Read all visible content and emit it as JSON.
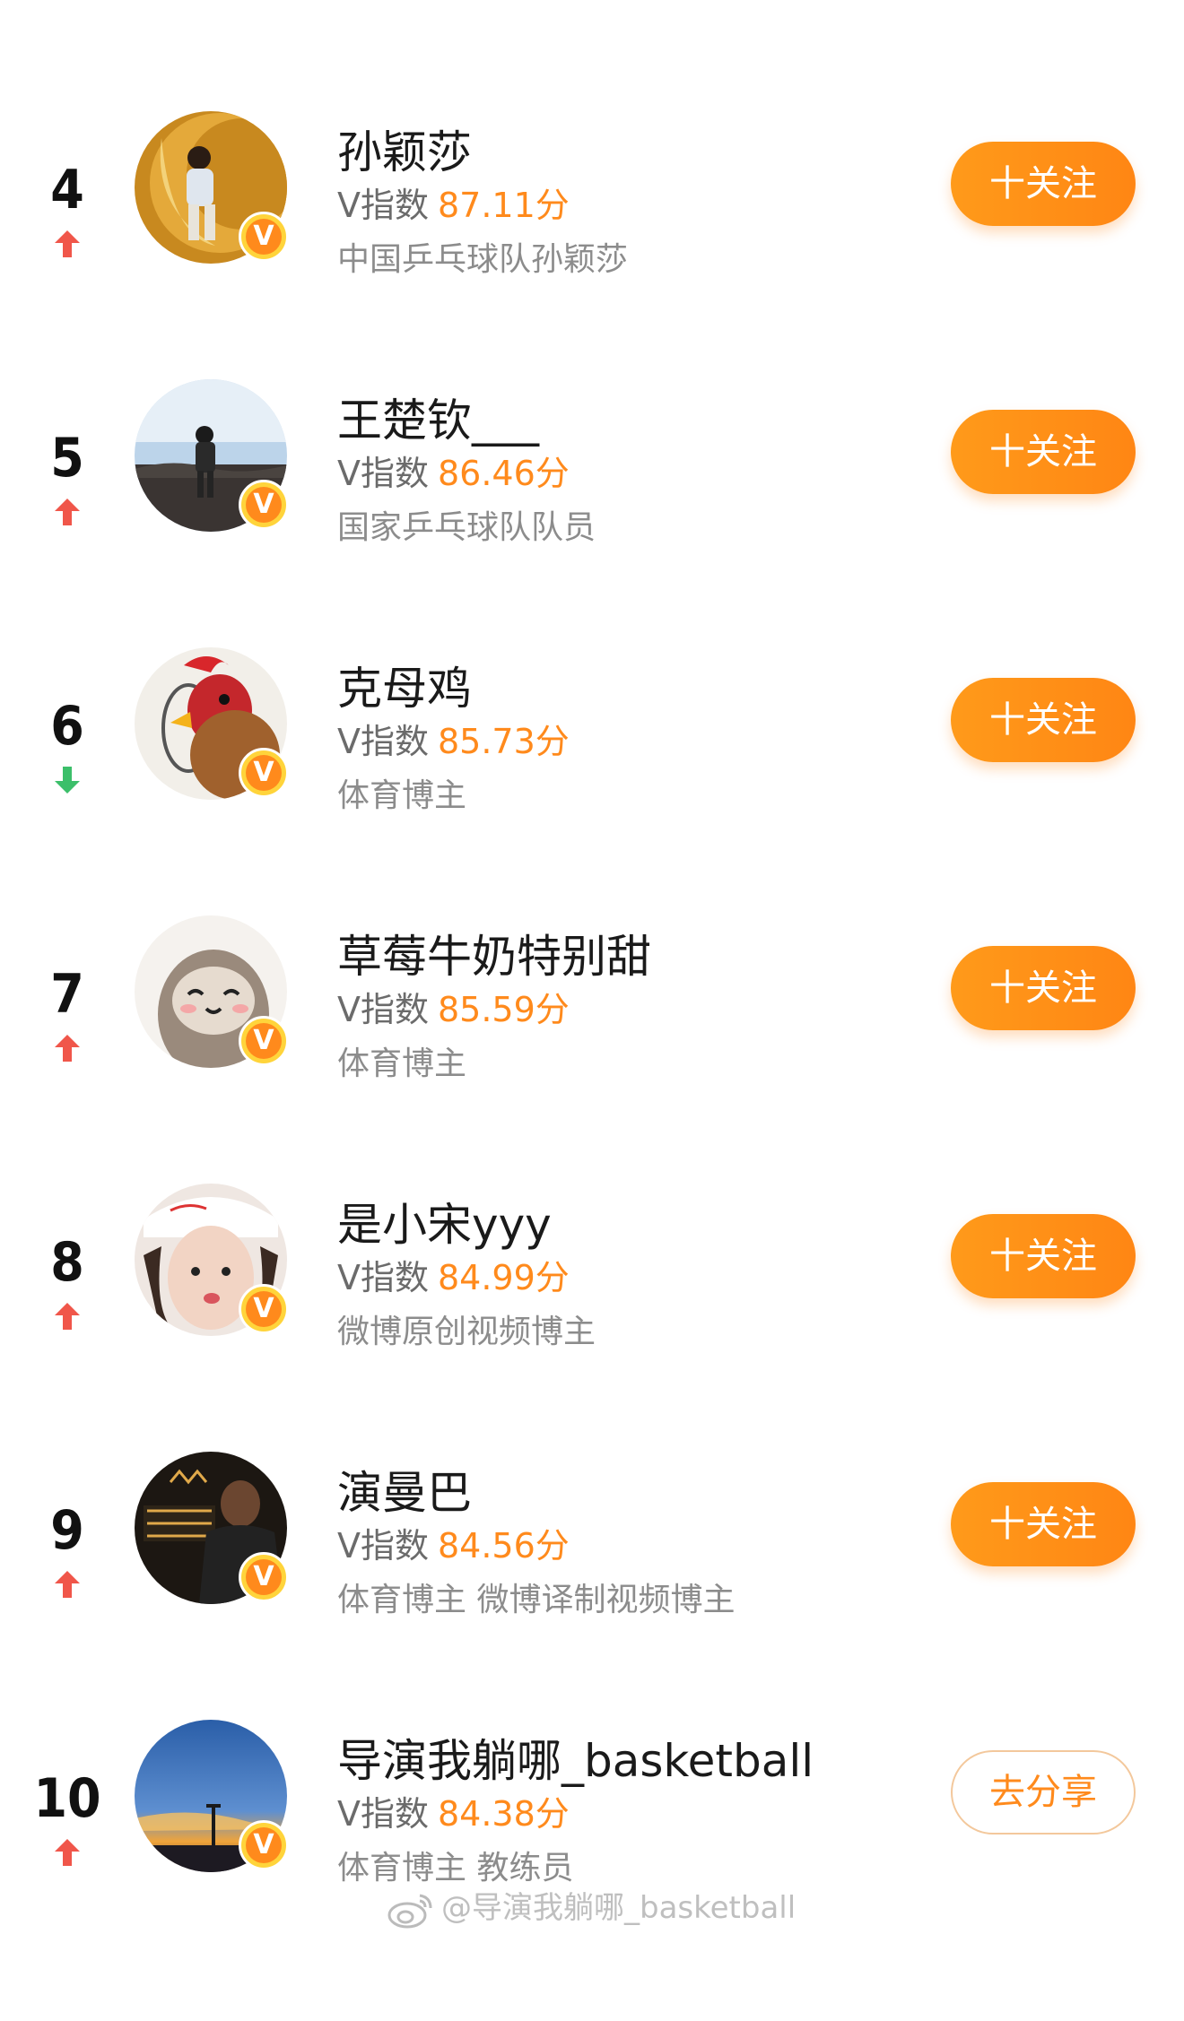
{
  "rows": [
    {
      "rank": "4",
      "trend": "up",
      "name": "孙颖莎",
      "score_label": "V指数",
      "score": "87.11分",
      "desc": "中国乒乓球队孙颖莎",
      "action": "十关注",
      "action_type": "follow"
    },
    {
      "rank": "5",
      "trend": "up",
      "name": "王楚钦___",
      "score_label": "V指数",
      "score": "86.46分",
      "desc": "国家乒乓球队队员",
      "action": "十关注",
      "action_type": "follow"
    },
    {
      "rank": "6",
      "trend": "down",
      "name": "克母鸡",
      "score_label": "V指数",
      "score": "85.73分",
      "desc": "体育博主",
      "action": "十关注",
      "action_type": "follow"
    },
    {
      "rank": "7",
      "trend": "up",
      "name": "草莓牛奶特别甜",
      "score_label": "V指数",
      "score": "85.59分",
      "desc": "体育博主",
      "action": "十关注",
      "action_type": "follow"
    },
    {
      "rank": "8",
      "trend": "up",
      "name": "是小宋yyy",
      "score_label": "V指数",
      "score": "84.99分",
      "desc": "微博原创视频博主",
      "action": "十关注",
      "action_type": "follow"
    },
    {
      "rank": "9",
      "trend": "up",
      "name": "演曼巴",
      "score_label": "V指数",
      "score": "84.56分",
      "desc": "体育博主 微博译制视频博主",
      "action": "十关注",
      "action_type": "follow"
    },
    {
      "rank": "10",
      "trend": "up",
      "name": "导演我躺哪_basketball",
      "score_label": "V指数",
      "score": "84.38分",
      "desc": "体育博主 教练员",
      "action": "去分享",
      "action_type": "share"
    }
  ],
  "badge_letter": "V",
  "watermark": "@导演我躺哪_basketball",
  "colors": {
    "accent": "#ff8a1c",
    "up": "#f0564a",
    "down": "#3cbf6a",
    "badge": "#ffd43b"
  }
}
